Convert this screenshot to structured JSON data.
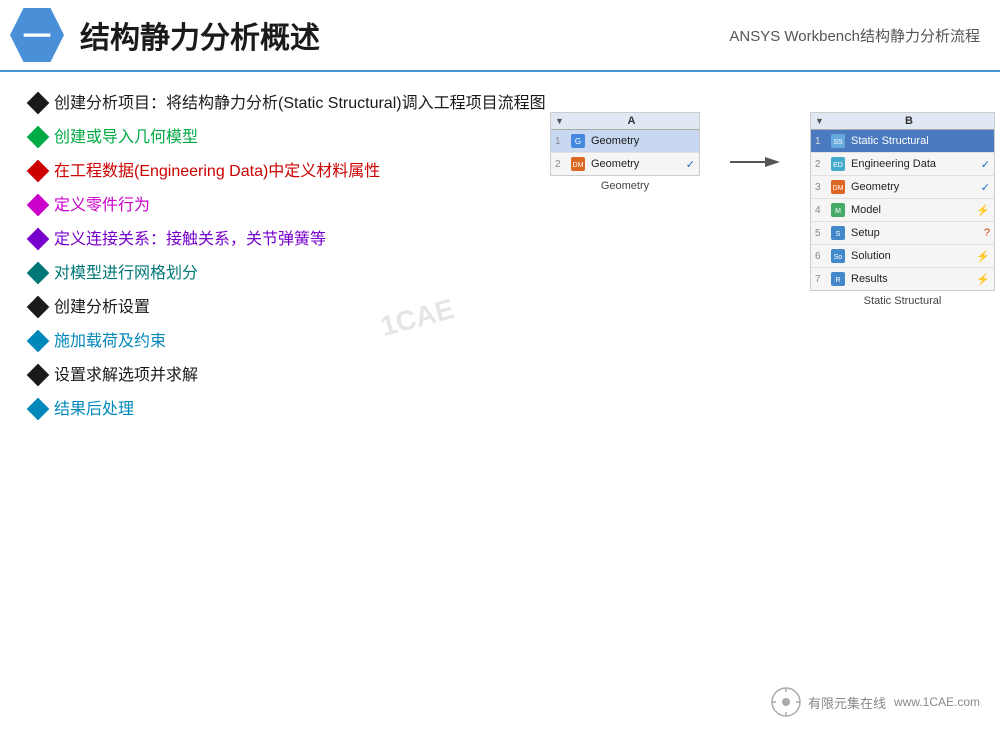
{
  "header": {
    "icon_label": "一",
    "title": "结构静力分析概述",
    "subtitle": "ANSYS Workbench结构静力分析流程"
  },
  "bullets": [
    {
      "id": 1,
      "color": "black",
      "diamond_color": "diamond-black",
      "text": "创建分析项目：将结构静力分析(Static Structural)调入工程项目流程图"
    },
    {
      "id": 2,
      "color": "green",
      "diamond_color": "diamond-green",
      "text": "创建或导入几何模型"
    },
    {
      "id": 3,
      "color": "red",
      "diamond_color": "diamond-red",
      "text": "在工程数据(Engineering Data)中定义材料属性"
    },
    {
      "id": 4,
      "color": "magenta",
      "diamond_color": "diamond-magenta",
      "text": "定义零件行为"
    },
    {
      "id": 5,
      "color": "purple",
      "diamond_color": "diamond-purple",
      "text": "定义连接关系：接触关系，关节弹簧等"
    },
    {
      "id": 6,
      "color": "teal",
      "diamond_color": "diamond-teal",
      "text": "对模型进行网格划分"
    },
    {
      "id": 7,
      "color": "black",
      "diamond_color": "diamond-black",
      "text": "创建分析设置"
    },
    {
      "id": 8,
      "color": "cyan-blue",
      "diamond_color": "diamond-cyan",
      "text": "施加载荷及约束"
    },
    {
      "id": 9,
      "color": "black",
      "diamond_color": "diamond-black",
      "text": "设置求解选项并求解"
    },
    {
      "id": 10,
      "color": "cyan-blue",
      "diamond_color": "diamond-cyan",
      "text": "结果后处理"
    }
  ],
  "diagram": {
    "block_a": {
      "header": "A",
      "rows": [
        {
          "num": "1",
          "icon": "geo",
          "label": "Geometry",
          "status": ""
        },
        {
          "num": "2",
          "icon": "dm",
          "label": "Geometry",
          "status": "✓"
        }
      ],
      "caption": "Geometry"
    },
    "block_b": {
      "header": "B",
      "rows": [
        {
          "num": "1",
          "icon": "structural",
          "label": "Static Structural",
          "status": ""
        },
        {
          "num": "2",
          "icon": "engdata",
          "label": "Engineering Data",
          "status": "✓"
        },
        {
          "num": "3",
          "icon": "dm",
          "label": "Geometry",
          "status": "✓"
        },
        {
          "num": "4",
          "icon": "model",
          "label": "Model",
          "status": "⚡"
        },
        {
          "num": "5",
          "icon": "setup",
          "label": "Setup",
          "status": "?"
        },
        {
          "num": "6",
          "icon": "solution",
          "label": "Solution",
          "status": "⚡"
        },
        {
          "num": "7",
          "icon": "results",
          "label": "Results",
          "status": "⚡"
        }
      ],
      "caption": "Static Structural"
    }
  },
  "watermark": "1CAE",
  "footer": {
    "brand": "有限元集在线",
    "url": "www.1CAE.com"
  }
}
